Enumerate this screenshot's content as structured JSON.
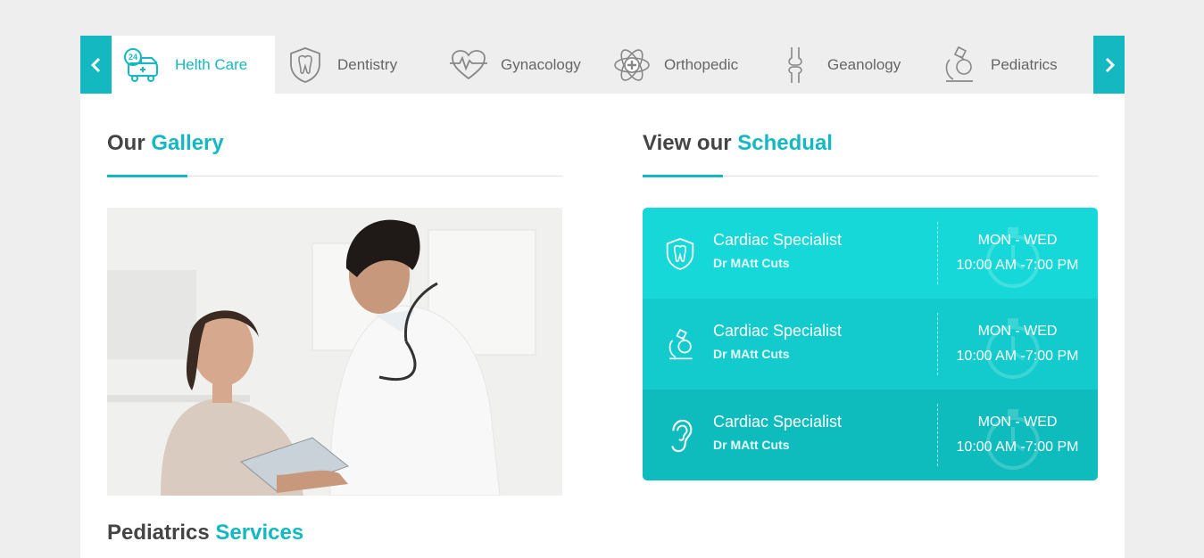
{
  "nav": {
    "prev_icon": "chevron-left-icon",
    "next_icon": "chevron-right-icon",
    "tabs": [
      {
        "label": "Helth Care",
        "icon": "24h-ambulance-icon",
        "active": true
      },
      {
        "label": "Dentistry",
        "icon": "tooth-shield-icon",
        "active": false
      },
      {
        "label": "Gynacology",
        "icon": "heartbeat-icon",
        "active": false
      },
      {
        "label": "Orthopedic",
        "icon": "medical-cross-atom-icon",
        "active": false
      },
      {
        "label": "Geanology",
        "icon": "bone-joint-icon",
        "active": false
      },
      {
        "label": "Pediatrics",
        "icon": "microscope-icon",
        "active": false
      }
    ]
  },
  "gallery": {
    "title_plain": "Our ",
    "title_accent": "Gallery"
  },
  "schedule": {
    "title_plain": "View our ",
    "title_accent": "Schedual",
    "rows": [
      {
        "title": "Cardiac Specialist",
        "doctor": "Dr MAtt Cuts",
        "days": "MON - WED",
        "hours": "10:00 AM -7:00 PM",
        "icon": "tooth-shield-icon",
        "bg": "#17d8d8"
      },
      {
        "title": "Cardiac Specialist",
        "doctor": "Dr MAtt Cuts",
        "days": "MON - WED",
        "hours": "10:00 AM -7:00 PM",
        "icon": "microscope-icon",
        "bg": "#13cbcd"
      },
      {
        "title": "Cardiac Specialist",
        "doctor": "Dr MAtt Cuts",
        "days": "MON - WED",
        "hours": "10:00 AM -7:00 PM",
        "icon": "ear-icon",
        "bg": "#0fbcbd"
      }
    ]
  },
  "services": {
    "title_plain": "Pediatrics ",
    "title_accent": "Services"
  },
  "colors": {
    "accent": "#14b8c0",
    "page_bg": "#eeeeee"
  }
}
